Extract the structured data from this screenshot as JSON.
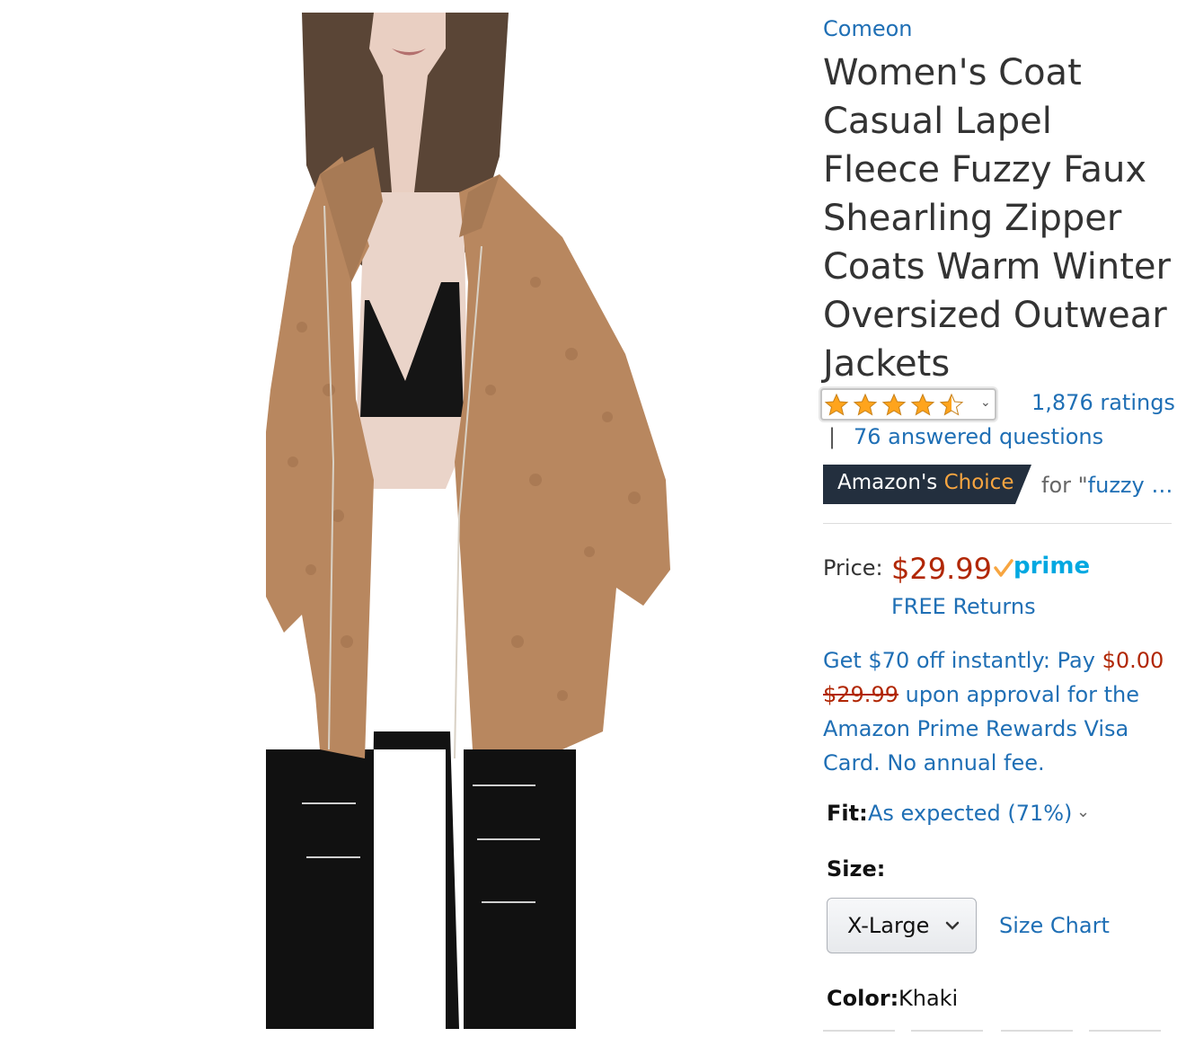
{
  "product": {
    "brand": "Comeon",
    "title": "Women's Coat Casual Lapel Fleece Fuzzy Faux Shearling Zipper Coats Warm Winter Oversized Outwear Jackets",
    "image_alt": "model wearing khaki fleece coat"
  },
  "rating": {
    "stars": 4.5,
    "ratings_count": "1,876 ratings",
    "answered_questions": "76 answered questions",
    "pipe": "|"
  },
  "badge": {
    "amazon": "Amazon's",
    "choice": "Choice",
    "for_prefix": "for \"",
    "query": "fuzzy …"
  },
  "price": {
    "label": "Price:",
    "value": "$29.99",
    "prime": "prime",
    "free_returns": "FREE Returns"
  },
  "offer": {
    "line1": "Get $70 off instantly: Pay ",
    "pay_amount": "$0.00",
    "struck_price": "$29.99",
    "line2": " upon approval for the Amazon Prime Rewards Visa Card. No annual fee."
  },
  "fit": {
    "label": "Fit:",
    "value": "As expected (71%)"
  },
  "size": {
    "label": "Size:",
    "selected": "X-Large",
    "chart_link": "Size Chart"
  },
  "color": {
    "label": "Color:",
    "value": "Khaki"
  },
  "colors": {
    "price_red": "#B12704",
    "link_blue": "#1F6FB5",
    "badge_dark": "#232F3E",
    "badge_orange": "#F7A540",
    "star": "#FFA41C",
    "prime_blue": "#00A8E1"
  }
}
